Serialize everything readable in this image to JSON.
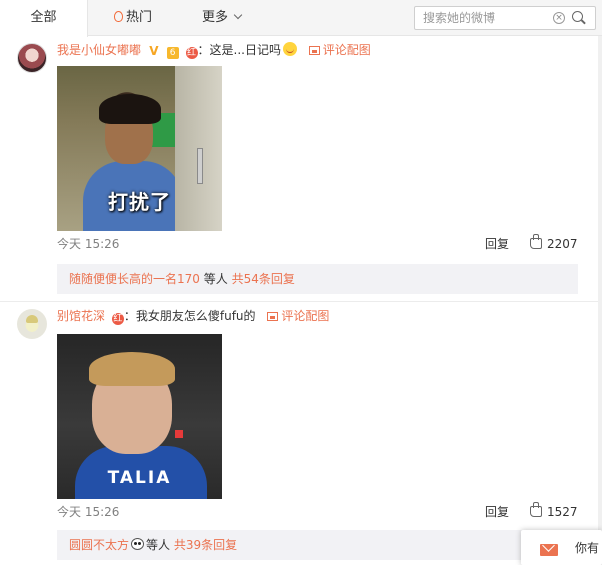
{
  "tabs": [
    {
      "label": "全部",
      "active": true
    },
    {
      "label": "热门",
      "icon": "fire-icon"
    },
    {
      "label": "更多",
      "icon": "chevron-down-icon"
    }
  ],
  "search": {
    "placeholder": "搜索她的微博"
  },
  "comments": [
    {
      "username": "我是小仙女嘟嘟",
      "badges": [
        "V",
        "6",
        "红"
      ],
      "text": "这是...日记吗",
      "emoji": "laughing-emoji",
      "pic_link": "评论配图",
      "image_caption": "打扰了",
      "time": "今天 15:26",
      "reply_label": "回复",
      "likes": "2207",
      "sub_replies": {
        "user": "随随便便长高的一名170",
        "middle": "等人",
        "count": "共54条回复"
      }
    },
    {
      "username": "别馆花深",
      "badges": [
        "红"
      ],
      "text": "我女朋友怎么傻fufu的",
      "pic_link": "评论配图",
      "image_caption": "TALIA",
      "time": "今天 15:26",
      "reply_label": "回复",
      "likes": "1527",
      "sub_replies": {
        "user": "圆圆不太方",
        "middle": "等人",
        "count": "共39条回复"
      }
    }
  ],
  "popup": {
    "text": "你有"
  },
  "colors": {
    "accent": "#eb7350",
    "background": "#ffffff",
    "subbox": "#f2f2f5"
  }
}
